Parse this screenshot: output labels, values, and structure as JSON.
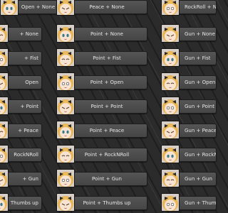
{
  "columns": [
    {
      "top_label": "Open + None",
      "items": [
        "+ None",
        "+ Fist",
        "Open",
        "+ Point",
        "+ Peace",
        "RockNRoll",
        "+ Gun",
        "Thumbs up"
      ]
    },
    {
      "top_label": "Peace + None",
      "items": [
        "Point + None",
        "Point + Fist",
        "Point + Open",
        "Point + Point",
        "Point + Peace",
        "Point + RockNRoll",
        "Point + Gun",
        "Point + Thumbs up"
      ]
    },
    {
      "top_label": "RockRoll + None",
      "items": [
        "Gun + None",
        "Gun + Fist",
        "Gun + Open",
        "Gun + Point",
        "Gun + Peace",
        "Gun + RockNRoll",
        "Gun + Gun",
        "Gun + Thumbs up"
      ]
    }
  ],
  "thumbnail_icon": "avatar-face-icon",
  "colors": {
    "canvas": "#2b2b2b",
    "node_fill": "#4c4c4c",
    "node_text": "#e6e6e6",
    "hair": "#e8b454",
    "ribbon": "#2a2a2a"
  }
}
